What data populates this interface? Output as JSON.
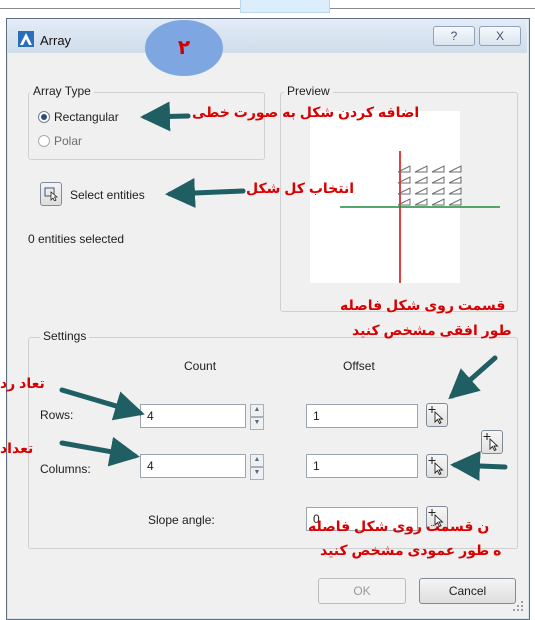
{
  "window": {
    "title": "Array",
    "help_glyph": "?",
    "close_glyph": "X",
    "step_badge": "٢"
  },
  "array_type": {
    "group_label": "Array Type",
    "options": [
      {
        "label": "Rectangular",
        "selected": true
      },
      {
        "label": "Polar",
        "selected": false
      }
    ]
  },
  "preview": {
    "group_label": "Preview"
  },
  "entities": {
    "select_button_label": "Select entities",
    "count_text": "0 entities selected"
  },
  "settings": {
    "group_label": "Settings",
    "count_header": "Count",
    "offset_header": "Offset",
    "rows_label": "Rows:",
    "rows_count": "4",
    "rows_offset": "1",
    "columns_label": "Columns:",
    "columns_count": "4",
    "columns_offset": "1",
    "slope_label": "Slope angle:",
    "slope_value": "0"
  },
  "footer": {
    "ok_label": "OK",
    "cancel_label": "Cancel"
  },
  "annotations": {
    "rectangular_note": "اضافه کردن شکل به صورت خطی",
    "select_note": "انتخاب کل شکل",
    "horizontal_offset_note_line1": "قسمت روی شکل فاصله",
    "horizontal_offset_note_line2": "طور افقی مشخص کنید",
    "rows_note": "تعاد رد",
    "columns_note": "تعداد",
    "vertical_offset_note_line1": "ن قسمت روی شکل فاصله",
    "vertical_offset_note_line2": "ه طور عمودی مشخص کنید"
  },
  "colors": {
    "annotation_text": "#d80000",
    "annotation_arrow": "#1f5f63",
    "badge": "#7ea6e0",
    "preview_axis_red": "#d40000",
    "preview_axis_green": "#1e8a3c"
  }
}
